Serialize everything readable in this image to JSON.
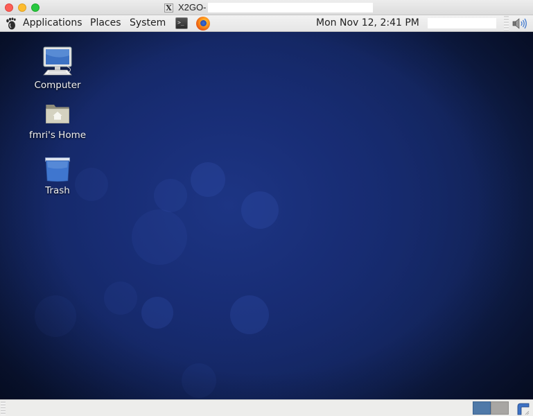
{
  "window": {
    "title": "X2GO-",
    "controls": [
      "close",
      "minimize",
      "maximize"
    ]
  },
  "top_panel": {
    "menus": [
      {
        "label": "Applications",
        "icon": "gnome-foot-icon"
      },
      {
        "label": "Places"
      },
      {
        "label": "System"
      }
    ],
    "launchers": [
      {
        "name": "terminal",
        "icon": "terminal-icon",
        "glyph": ">_"
      },
      {
        "name": "firefox",
        "icon": "firefox-icon"
      }
    ],
    "clock": "Mon Nov 12,  2:41 PM",
    "tray": [
      {
        "name": "volume",
        "icon": "volume-icon"
      }
    ]
  },
  "desktop": {
    "background_color": "#15296c",
    "icons": [
      {
        "label": "Computer",
        "icon": "computer-icon"
      },
      {
        "label": "fmri's Home",
        "icon": "home-folder-icon"
      },
      {
        "label": "Trash",
        "icon": "trash-icon"
      }
    ]
  },
  "bottom_panel": {
    "workspaces": [
      {
        "name": "Workspace 1",
        "active": true,
        "color": "#4f79a8"
      },
      {
        "name": "Workspace 2",
        "active": false,
        "color": "#a8a6a3"
      }
    ],
    "show_desktop": "show-desktop-icon"
  }
}
